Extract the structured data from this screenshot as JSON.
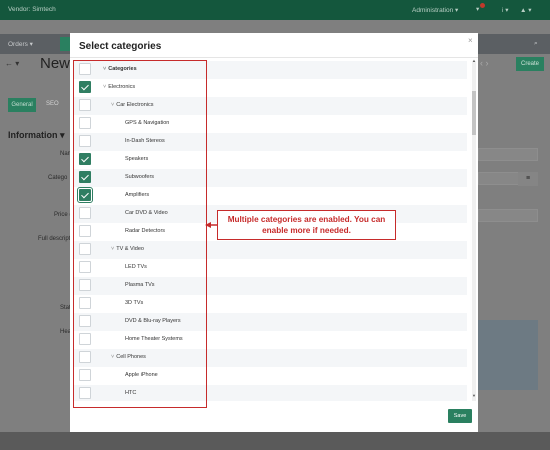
{
  "colors": {
    "brand_green": "#14573d",
    "accent_green": "#2a8060",
    "annotation_red": "#c62b2b",
    "checked": "#2f7e62"
  },
  "topbar": {
    "brand": "Vendor: Simtech",
    "admin": "Administration ▾",
    "help_icon": "help-icon",
    "user_icon": "user-icon"
  },
  "secbar": {
    "orders": "Orders ▾",
    "tab_stub": "P"
  },
  "titlebar": {
    "nav": "←  ▾",
    "title": "New p",
    "create": "Create"
  },
  "tabs": {
    "general": "General",
    "seo": "SEO"
  },
  "info_heading": "Information ▾",
  "field_labels": [
    "Nam",
    "Catego",
    "Price (",
    "Full descript",
    "Stat",
    "Hea"
  ],
  "modal": {
    "title": "Select categories",
    "close": "×",
    "save": "Save",
    "rows": [
      {
        "label": "Categories",
        "level": 0,
        "caret": true,
        "checked": false,
        "bold": true
      },
      {
        "label": "Electronics",
        "level": 0,
        "caret": true,
        "checked": true,
        "bold": false
      },
      {
        "label": "Car Electronics",
        "level": 1,
        "caret": true,
        "checked": false,
        "bold": false
      },
      {
        "label": "GPS & Navigation",
        "level": 2,
        "caret": false,
        "checked": false,
        "bold": false
      },
      {
        "label": "In-Dash Stereos",
        "level": 2,
        "caret": false,
        "checked": false,
        "bold": false
      },
      {
        "label": "Speakers",
        "level": 2,
        "caret": false,
        "checked": true,
        "bold": false
      },
      {
        "label": "Subwoofers",
        "level": 2,
        "caret": false,
        "checked": true,
        "bold": false
      },
      {
        "label": "Amplifiers",
        "level": 2,
        "caret": false,
        "checked": true,
        "bold": false,
        "focus": true
      },
      {
        "label": "Car DVD & Video",
        "level": 2,
        "caret": false,
        "checked": false,
        "bold": false
      },
      {
        "label": "Radar Detectors",
        "level": 2,
        "caret": false,
        "checked": false,
        "bold": false
      },
      {
        "label": "TV & Video",
        "level": 1,
        "caret": true,
        "checked": false,
        "bold": false
      },
      {
        "label": "LED TVs",
        "level": 2,
        "caret": false,
        "checked": false,
        "bold": false
      },
      {
        "label": "Plasma TVs",
        "level": 2,
        "caret": false,
        "checked": false,
        "bold": false
      },
      {
        "label": "3D TVs",
        "level": 2,
        "caret": false,
        "checked": false,
        "bold": false
      },
      {
        "label": "DVD & Blu-ray Players",
        "level": 2,
        "caret": false,
        "checked": false,
        "bold": false
      },
      {
        "label": "Home Theater Systems",
        "level": 2,
        "caret": false,
        "checked": false,
        "bold": false
      },
      {
        "label": "Cell Phones",
        "level": 1,
        "caret": true,
        "checked": false,
        "bold": false
      },
      {
        "label": "Apple iPhone",
        "level": 2,
        "caret": false,
        "checked": false,
        "bold": false
      },
      {
        "label": "HTC",
        "level": 2,
        "caret": false,
        "checked": false,
        "bold": false
      }
    ]
  },
  "annotation": {
    "callout": "Multiple categories are enabled. You can enable more if needed."
  }
}
